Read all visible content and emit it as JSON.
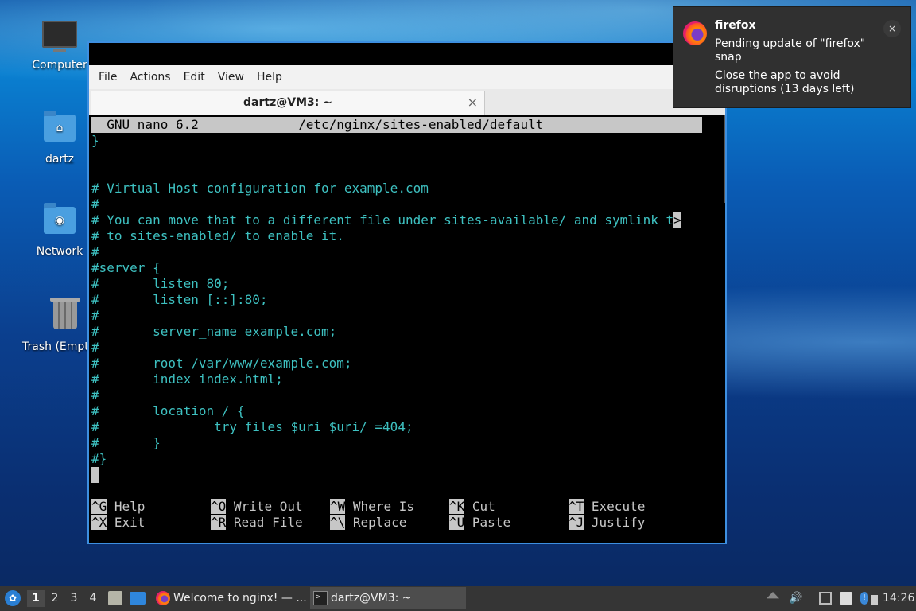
{
  "desktop": {
    "icons": [
      {
        "label": "Computer",
        "icon": "computer-icon"
      },
      {
        "label": "dartz",
        "icon": "home-folder-icon"
      },
      {
        "label": "Network",
        "icon": "network-folder-icon"
      },
      {
        "label": "Trash (Empt",
        "icon": "trash-icon"
      }
    ]
  },
  "terminal": {
    "menu": [
      "File",
      "Actions",
      "Edit",
      "View",
      "Help"
    ],
    "tab_title": "dartz@VM3: ~",
    "tab_close": "×",
    "nano": {
      "header": "  GNU nano 6.2             /etc/nginx/sites-enabled/default",
      "lines": [
        "}",
        "",
        "",
        "# Virtual Host configuration for example.com",
        "#",
        "# You can move that to a different file under sites-available/ and symlink t",
        "# to sites-enabled/ to enable it.",
        "#",
        "#server {",
        "#       listen 80;",
        "#       listen [::]:80;",
        "#",
        "#       server_name example.com;",
        "#",
        "#       root /var/www/example.com;",
        "#       index index.html;",
        "#",
        "#       location / {",
        "#               try_files $uri $uri/ =404;",
        "#       }",
        "#}"
      ],
      "overflow_marker": ">",
      "shortcuts": [
        {
          "key": "^G",
          "label": "Help"
        },
        {
          "key": "^O",
          "label": "Write Out"
        },
        {
          "key": "^W",
          "label": "Where Is"
        },
        {
          "key": "^K",
          "label": "Cut"
        },
        {
          "key": "^T",
          "label": "Execute"
        },
        {
          "key": "^X",
          "label": "Exit"
        },
        {
          "key": "^R",
          "label": "Read File"
        },
        {
          "key": "^\\",
          "label": "Replace"
        },
        {
          "key": "^U",
          "label": "Paste"
        },
        {
          "key": "^J",
          "label": "Justify"
        }
      ]
    }
  },
  "notification": {
    "app": "firefox",
    "line1": "Pending update of \"firefox\" snap",
    "line2": "Close the app to avoid disruptions (13 days left)",
    "close": "×"
  },
  "taskbar": {
    "workspaces": [
      "1",
      "2",
      "3",
      "4"
    ],
    "active_workspace": "1",
    "tasks": [
      {
        "label": "Welcome to nginx! — ...",
        "icon": "firefox-icon"
      },
      {
        "label": "dartz@VM3: ~",
        "icon": "terminal-icon"
      }
    ],
    "clock": "14:26"
  },
  "colors": {
    "terminal_text": "#3ec1c1",
    "nano_bar": "#c7c7c7",
    "window_border": "#3d8fe0"
  }
}
